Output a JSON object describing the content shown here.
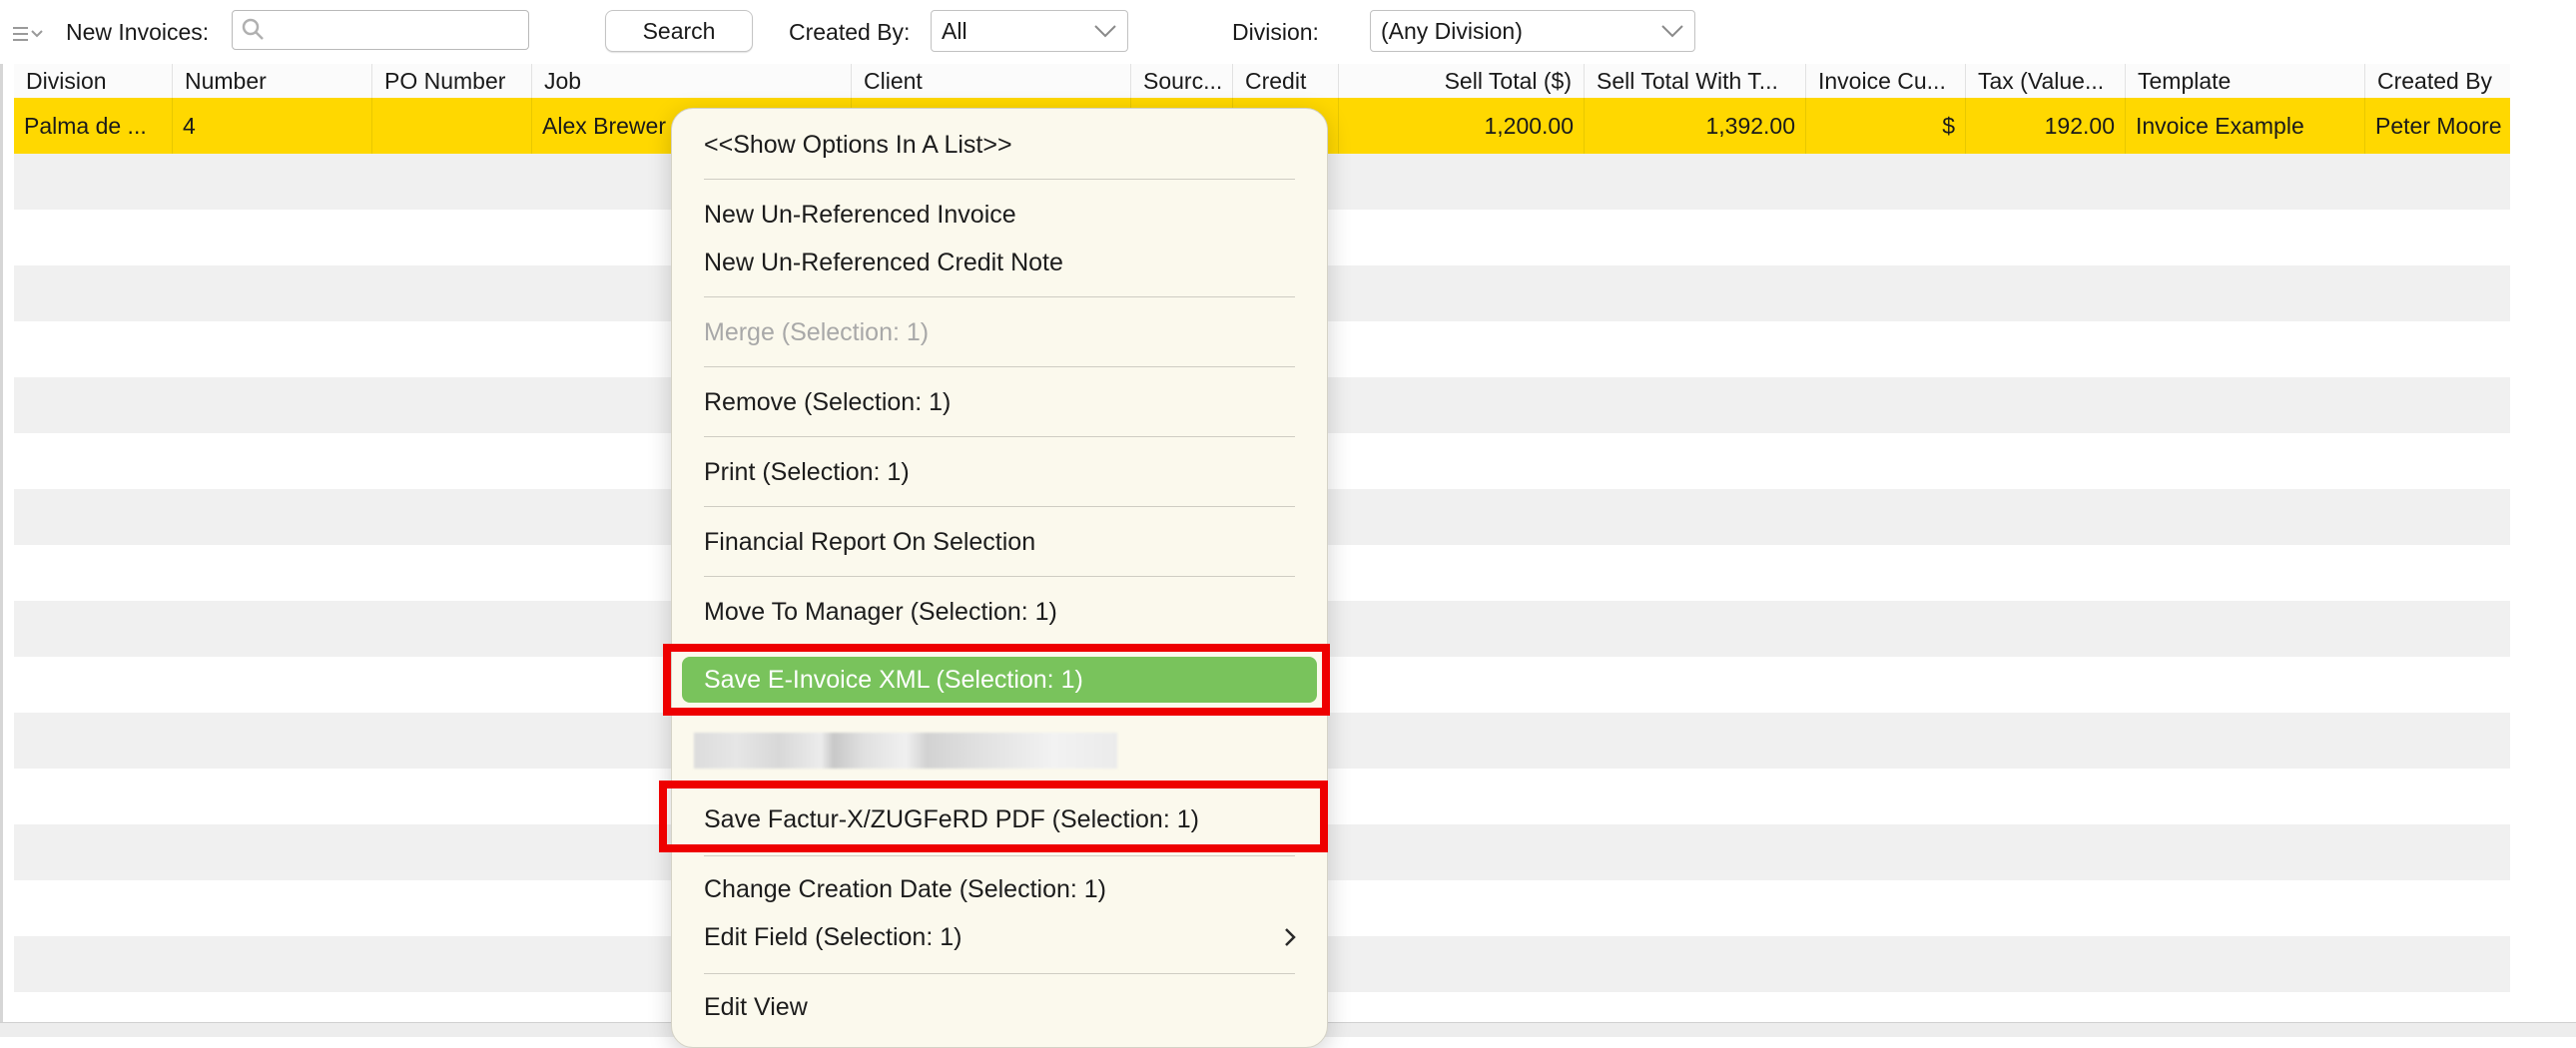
{
  "toolbar": {
    "new_invoices_label": "New Invoices:",
    "search_value": "",
    "search_button": "Search",
    "created_by_label": "Created By:",
    "created_by_value": "All",
    "division_label": "Division:",
    "division_value": "(Any Division)"
  },
  "table": {
    "columns": [
      "Division",
      "Number",
      "PO Number",
      "Job",
      "Client",
      "Sourc...",
      "Credit",
      "Sell Total ($)",
      "Sell Total With T...",
      "Invoice Cu...",
      "Tax (Value...",
      "Template",
      "Created By"
    ],
    "rows": [
      {
        "division": "Palma de ...",
        "number": "4",
        "po_number": "",
        "job": "Alex Brewer",
        "client": "",
        "source": "",
        "credit": "",
        "sell_total": "1,200.00",
        "sell_total_with_tax": "1,392.00",
        "invoice_currency": "$",
        "tax_value": "192.00",
        "template": "Invoice Example",
        "created_by": "Peter Moore"
      }
    ]
  },
  "context_menu": {
    "items": [
      {
        "label": "<<Show Options In A List>>",
        "enabled": true
      },
      {
        "label": "New Un-Referenced Invoice",
        "enabled": true
      },
      {
        "label": "New Un-Referenced Credit Note",
        "enabled": true
      },
      {
        "label": "Merge (Selection: 1)",
        "enabled": false
      },
      {
        "label": "Remove (Selection: 1)",
        "enabled": true
      },
      {
        "label": "Print (Selection: 1)",
        "enabled": true
      },
      {
        "label": "Financial Report On Selection",
        "enabled": true
      },
      {
        "label": "Move To Manager (Selection: 1)",
        "enabled": true
      },
      {
        "label": "Save E-Invoice XML (Selection: 1)",
        "enabled": true,
        "highlighted": true
      },
      {
        "label": "Save Factur-X/ZUGFeRD PDF (Selection: 1)",
        "enabled": true
      },
      {
        "label": "Change Creation Date (Selection: 1)",
        "enabled": true
      },
      {
        "label": "Edit Field (Selection: 1)",
        "enabled": true,
        "submenu": true
      },
      {
        "label": "Edit View",
        "enabled": true
      }
    ]
  },
  "colors": {
    "selected_row": "#ffd800",
    "menu_highlight": "#79c35c",
    "annotation_box": "#ee0000",
    "menu_background": "#fbf9ed",
    "stripe": "#f0f0f0"
  },
  "icons": {
    "list_menu": "list-options-icon",
    "search": "magnifier-icon",
    "dropdown": "chevron-down-icon",
    "submenu": "chevron-right-icon"
  }
}
